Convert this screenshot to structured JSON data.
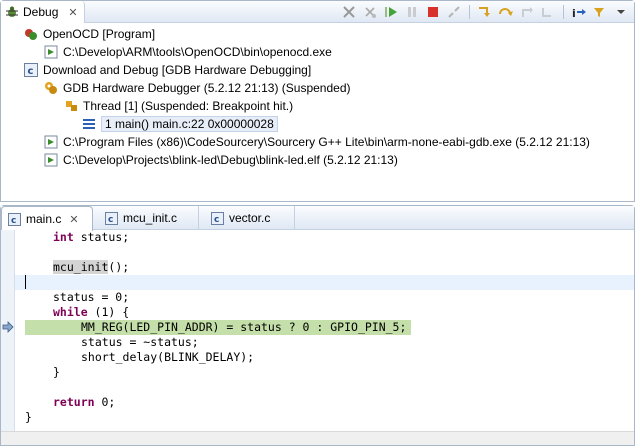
{
  "debug_view": {
    "title": "Debug",
    "close_glyph": "✕",
    "toolbar_icons": [
      "remove-launch-icon",
      "remove-all-icon",
      "resume-icon",
      "suspend-icon",
      "terminate-icon",
      "disconnect-icon",
      "step-into-icon",
      "step-over-icon",
      "step-return-icon",
      "drop-to-frame-icon",
      "instruction-step-icon",
      "use-step-filters-icon",
      "view-menu-icon"
    ],
    "tree": [
      {
        "label": "OpenOCD [Program]",
        "icon": "launch-icon"
      },
      {
        "label": "C:\\Develop\\ARM\\tools\\OpenOCD\\bin\\openocd.exe",
        "icon": "process-icon"
      },
      {
        "label": "Download and Debug [GDB Hardware Debugging]",
        "icon": "c-launch-icon"
      },
      {
        "label": "GDB Hardware Debugger (5.2.12 21:13) (Suspended)",
        "icon": "debugger-icon"
      },
      {
        "label": "Thread [1] (Suspended: Breakpoint hit.)",
        "icon": "thread-icon"
      },
      {
        "label": "1 main() main.c:22 0x00000028",
        "icon": "stack-frame-icon"
      },
      {
        "label": "C:\\Program Files (x86)\\CodeSourcery\\Sourcery G++ Lite\\bin\\arm-none-eabi-gdb.exe (5.2.12 21:13)",
        "icon": "process-icon"
      },
      {
        "label": "C:\\Develop\\Projects\\blink-led\\Debug\\blink-led.elf (5.2.12 21:13)",
        "icon": "process-icon"
      }
    ]
  },
  "editor": {
    "tabs": [
      {
        "label": "main.c",
        "active": true
      },
      {
        "label": "mcu_init.c",
        "active": false
      },
      {
        "label": "vector.c",
        "active": false
      }
    ],
    "close_glyph": "✕",
    "lines": {
      "l1_kw": "int",
      "l1_rest": " status;",
      "l3_call": "mcu_init",
      "l3_rest": "();",
      "l5": "status = 0;",
      "l6_kw": "while",
      "l6_rest": " (1) {",
      "l7": "MM_REG(LED_PIN_ADDR) = status ? 0 : GPIO_PIN_5;",
      "l8": "status = ~status;",
      "l9": "short_delay(BLINK_DELAY);",
      "l10": "}",
      "l12_kw": "return",
      "l12_rest": " 0;",
      "l13": "}"
    }
  },
  "colors": {
    "keyword": "#7f0055",
    "current_line": "#e8f2fe",
    "execution_highlight": "#c4dfa9"
  }
}
